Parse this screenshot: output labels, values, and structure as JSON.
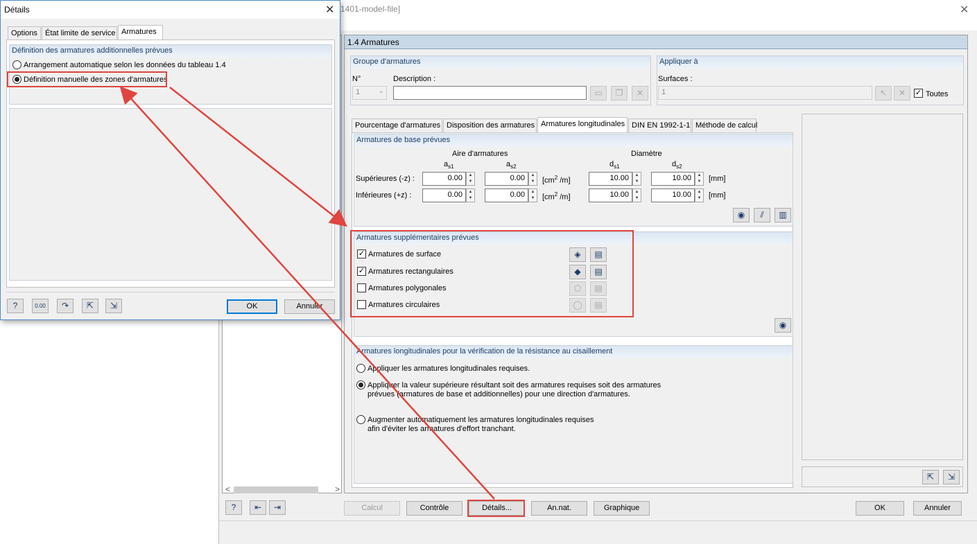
{
  "main": {
    "title": "1401-model-file]",
    "close_glyph": "✕",
    "section_title": "1.4 Armatures",
    "groupe": {
      "head": "Groupe d'armatures",
      "no_label": "N°",
      "no_value": "1",
      "desc_label": "Description :",
      "desc_value": ""
    },
    "appliquer": {
      "head": "Appliquer à",
      "surfaces_label": "Surfaces :",
      "surfaces_value": "1",
      "toutes_label": "Toutes"
    },
    "tabs": [
      "Pourcentage d'armatures",
      "Disposition des armatures",
      "Armatures longitudinales",
      "DIN EN 1992-1-1",
      "Méthode de calcul"
    ],
    "base": {
      "head": "Armatures de base prévues",
      "aire_label": "Aire d'armatures",
      "diametre_label": "Diamètre",
      "as1": "a",
      "as1_sub": "s1",
      "as2": "a",
      "as2_sub": "s2",
      "ds1": "d",
      "ds1_sub": "s1",
      "ds2": "d",
      "ds2_sub": "s2",
      "sup_label": "Supérieures (-z) :",
      "inf_label": "Inférieures (+z) :",
      "unit_area_a": "[cm",
      "unit_area_sup": "2",
      "unit_area_b": " /m]",
      "unit_mm": "[mm]",
      "sup_as1": "0.00",
      "sup_as2": "0.00",
      "sup_ds1": "10.00",
      "sup_ds2": "10.00",
      "inf_as1": "0.00",
      "inf_as2": "0.00",
      "inf_ds1": "10.00",
      "inf_ds2": "10.00"
    },
    "supp": {
      "head": "Armatures supplémentaires prévues",
      "items": [
        {
          "label": "Armatures de surface",
          "checked": true
        },
        {
          "label": "Armatures rectangulaires",
          "checked": true
        },
        {
          "label": "Armatures polygonales",
          "checked": false
        },
        {
          "label": "Armatures circulaires",
          "checked": false
        }
      ]
    },
    "long": {
      "head": "Armatures longitudinales pour la vérification de la résistance au cisaillement",
      "opt1": "Appliquer les armatures longitudinales requises.",
      "opt2_l1": "Appliquer la valeur supérieure résultant soit des armatures requises soit des armatures",
      "opt2_l2": "prévues (armatures de base et additionnelles) pour une direction d'armatures.",
      "opt3_l1": "Augmenter automatiquement les armatures longitudinales requises",
      "opt3_l2": "afin d'éviter les armatures d'effort tranchant.",
      "selected": 2
    },
    "buttons": {
      "calcul": "Calcul",
      "controle": "Contrôle",
      "details": "Détails...",
      "annat": "An.nat.",
      "graphique": "Graphique",
      "ok": "OK",
      "annuler": "Annuler"
    },
    "scroll_left": "<",
    "scroll_right": ">"
  },
  "details": {
    "title": "Détails",
    "close_glyph": "✕",
    "tabs": [
      "Options",
      "État limite de service",
      "Armatures"
    ],
    "group_head": "Définition des armatures additionnelles prévues",
    "opt_auto": "Arrangement automatique selon les données du tableau 1.4",
    "opt_manual": "Définition manuelle des zones d'armatures",
    "selected": "manual",
    "ok": "OK",
    "annuler": "Annuler",
    "num_icon_text": "0.00"
  },
  "colors": {
    "annotation_red": "#e0453f",
    "group_head_text": "#1e3f66",
    "section_header_bg": "#c8d8e6"
  }
}
